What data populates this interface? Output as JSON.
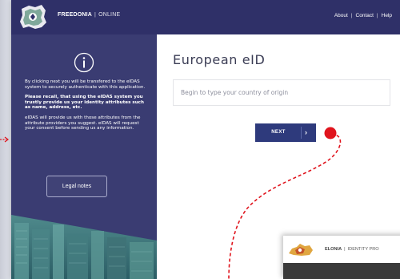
{
  "header": {
    "brand_name": "FREEDONIA",
    "brand_separator": "|",
    "brand_suffix": "ONLINE",
    "nav": [
      {
        "label": "About"
      },
      {
        "label": "Contact"
      },
      {
        "label": "Help"
      }
    ],
    "nav_separator": "|"
  },
  "info_panel": {
    "icon": "info-circle-icon",
    "paragraph_1": "By clicking next you will be transfered to the eIDAS system to securely authenticate with this application.",
    "paragraph_2": "Please recall, that using the eIDAS system you trustly provide us your identity attributes such as name, address, etc.",
    "paragraph_3": "eIDAS will provide us with those attributes from the attribute providers you suggest. eIDAS will request your consent before sending us any information.",
    "legal_button": "Legal notes"
  },
  "main": {
    "title": "European eID",
    "country_input_placeholder": "Begin to type your country of origin",
    "next_button": "NEXT",
    "next_chevron": "›"
  },
  "overlay_window": {
    "brand_name": "ELONIA",
    "brand_separator": "|",
    "brand_suffix": "IDENTITY PRO"
  },
  "colors": {
    "header_bg": "#2f3068",
    "panel_bg": "#3a3c72",
    "button_bg": "#2e3a7c",
    "annotation_red": "#e0141d"
  }
}
